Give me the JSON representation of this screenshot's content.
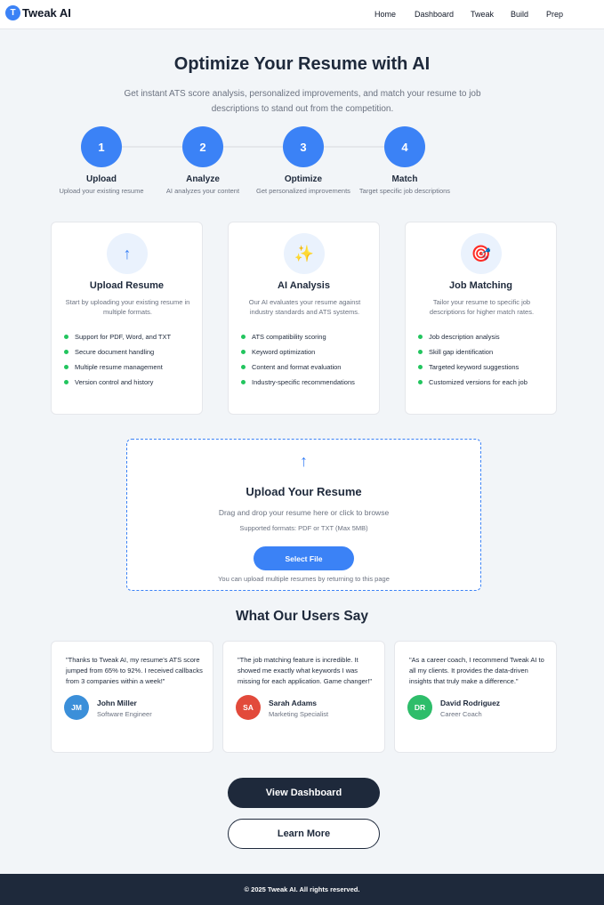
{
  "nav": {
    "logo_letter": "T",
    "brand": "Tweak AI",
    "links": [
      "Home",
      "Dashboard",
      "Tweak",
      "Build",
      "Prep"
    ]
  },
  "hero": {
    "title": "Optimize Your Resume with AI",
    "subtitle": "Get instant ATS score analysis, personalized improvements, and match your resume to job descriptions to stand out from the competition."
  },
  "steps": [
    {
      "number": "1",
      "title": "Upload",
      "desc": "Upload your existing resume"
    },
    {
      "number": "2",
      "title": "Analyze",
      "desc": "AI analyzes your content"
    },
    {
      "number": "3",
      "title": "Optimize",
      "desc": "Get personalized improvements"
    },
    {
      "number": "4",
      "title": "Match",
      "desc": "Target specific job descriptions"
    }
  ],
  "features": [
    {
      "icon": "↑",
      "icon_name": "upload-arrow-icon",
      "title": "Upload Resume",
      "desc": "Start by uploading your existing resume in multiple formats.",
      "items": [
        "Support for PDF, Word, and TXT",
        "Secure document handling",
        "Multiple resume management",
        "Version control and history"
      ]
    },
    {
      "icon": "✨",
      "icon_name": "sparkles-icon",
      "title": "AI Analysis",
      "desc": "Our AI evaluates your resume against industry standards and ATS systems.",
      "items": [
        "ATS compatibility scoring",
        "Keyword optimization",
        "Content and format evaluation",
        "Industry-specific recommendations"
      ]
    },
    {
      "icon": "🎯",
      "icon_name": "target-icon",
      "title": "Job Matching",
      "desc": "Tailor your resume to specific job descriptions for higher match rates.",
      "items": [
        "Job description analysis",
        "Skill gap identification",
        "Targeted keyword suggestions",
        "Customized versions for each job"
      ]
    }
  ],
  "upload": {
    "icon": "↑",
    "title": "Upload Your Resume",
    "desc": "Drag and drop your resume here or click to browse",
    "formats": "Supported formats: PDF or TXT (Max 5MB)",
    "button": "Select File",
    "note": "You can upload multiple resumes by returning to this page"
  },
  "testimonials": {
    "title": "What Our Users Say",
    "items": [
      {
        "quote": "\"Thanks to Tweak AI, my resume's ATS score jumped from 65% to 92%. I received callbacks from 3 companies within a week!\"",
        "initials": "JM",
        "name": "John Miller",
        "role": "Software Engineer",
        "color": "#3b8fd9"
      },
      {
        "quote": "\"The job matching feature is incredible. It showed me exactly what keywords I was missing for each application. Game changer!\"",
        "initials": "SA",
        "name": "Sarah Adams",
        "role": "Marketing Specialist",
        "color": "#e24a3b"
      },
      {
        "quote": "\"As a career coach, I recommend Tweak AI to all my clients. It provides the data-driven insights that truly make a difference.\"",
        "initials": "DR",
        "name": "David Rodriguez",
        "role": "Career Coach",
        "color": "#2ebd6a"
      }
    ]
  },
  "actions": {
    "view_dashboard": "View Dashboard",
    "learn_more": "Learn More"
  },
  "footer": {
    "text": "© 2025 Tweak AI. All rights reserved."
  },
  "colors": {
    "accent": "#3b82f6",
    "dark": "#1e293b",
    "check": "#22c55e"
  }
}
